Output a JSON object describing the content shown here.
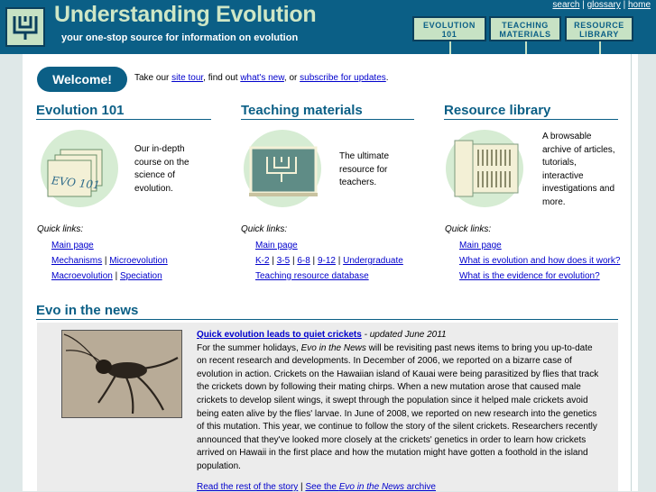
{
  "header": {
    "title": "Understanding Evolution",
    "tagline": "your one-stop source for information on evolution",
    "toplinks": [
      "search",
      "glossary",
      "home"
    ],
    "nav_tabs": [
      {
        "line1": "EVOLUTION",
        "line2": "101"
      },
      {
        "line1": "TEACHING",
        "line2": "MATERIALS"
      },
      {
        "line1": "RESOURCE",
        "line2": "LIBRARY"
      }
    ]
  },
  "welcome": {
    "button": "Welcome!",
    "prefix": "Take our ",
    "link1": "site tour",
    "mid1": ", find out ",
    "link2": "what's new",
    "mid2": ", or ",
    "link3": "subscribe for updates",
    "suffix": "."
  },
  "columns": [
    {
      "heading": "Evolution 101",
      "icon": "folders-icon",
      "folder_label": "EVO 101",
      "description": "Our in-depth course on the science of evolution.",
      "quicklinks_label": "Quick links:",
      "links": [
        [
          "Main page"
        ],
        [
          "Mechanisms",
          "Microevolution"
        ],
        [
          "Macroevolution",
          "Speciation"
        ]
      ]
    },
    {
      "heading": "Teaching materials",
      "icon": "chalkboard-icon",
      "description": "The ultimate resource for teachers.",
      "quicklinks_label": "Quick links:",
      "links": [
        [
          "Main page"
        ],
        [
          "K-2",
          "3-5",
          "6-8",
          "9-12",
          "Undergraduate"
        ],
        [
          "Teaching resource database"
        ]
      ]
    },
    {
      "heading": "Resource library",
      "icon": "bookshelf-icon",
      "description": "A browsable archive of articles, tutorials, interactive investigations and more.",
      "quicklinks_label": "Quick links:",
      "links": [
        [
          "Main page"
        ],
        [
          "What is evolution and how does it work?"
        ],
        [
          "What is the evidence for evolution?"
        ]
      ]
    }
  ],
  "news": {
    "heading": "Evo in the news",
    "image": "cricket-photo",
    "article_title": "Quick evolution leads to quiet crickets",
    "updated": " - updated June 2011",
    "body_1": "For the summer holidays, ",
    "body_em": "Evo in the News",
    "body_2": " will be revisiting past news items to bring you up-to-date on recent research and developments. In December of 2006, we reported on a bizarre case of evolution in action. Crickets on the Hawaiian island of Kauai were being parasitized by flies that track the crickets down by following their mating chirps. When a new mutation arose that caused male crickets to develop silent wings, it swept through the population since it helped male crickets avoid being eaten alive by the flies' larvae. In June of 2008, we reported on new research into the genetics of this mutation. This year, we continue to follow the story of the silent crickets. Researchers recently announced that they've looked more closely at the crickets' genetics in order to learn how crickets arrived on Hawaii in the first place and how the mutation might have gotten a foothold in the island population.",
    "more_link": "Read the rest of the story",
    "see_prefix": "See the ",
    "see_em": "Evo in the News",
    "see_suffix": " archive"
  }
}
